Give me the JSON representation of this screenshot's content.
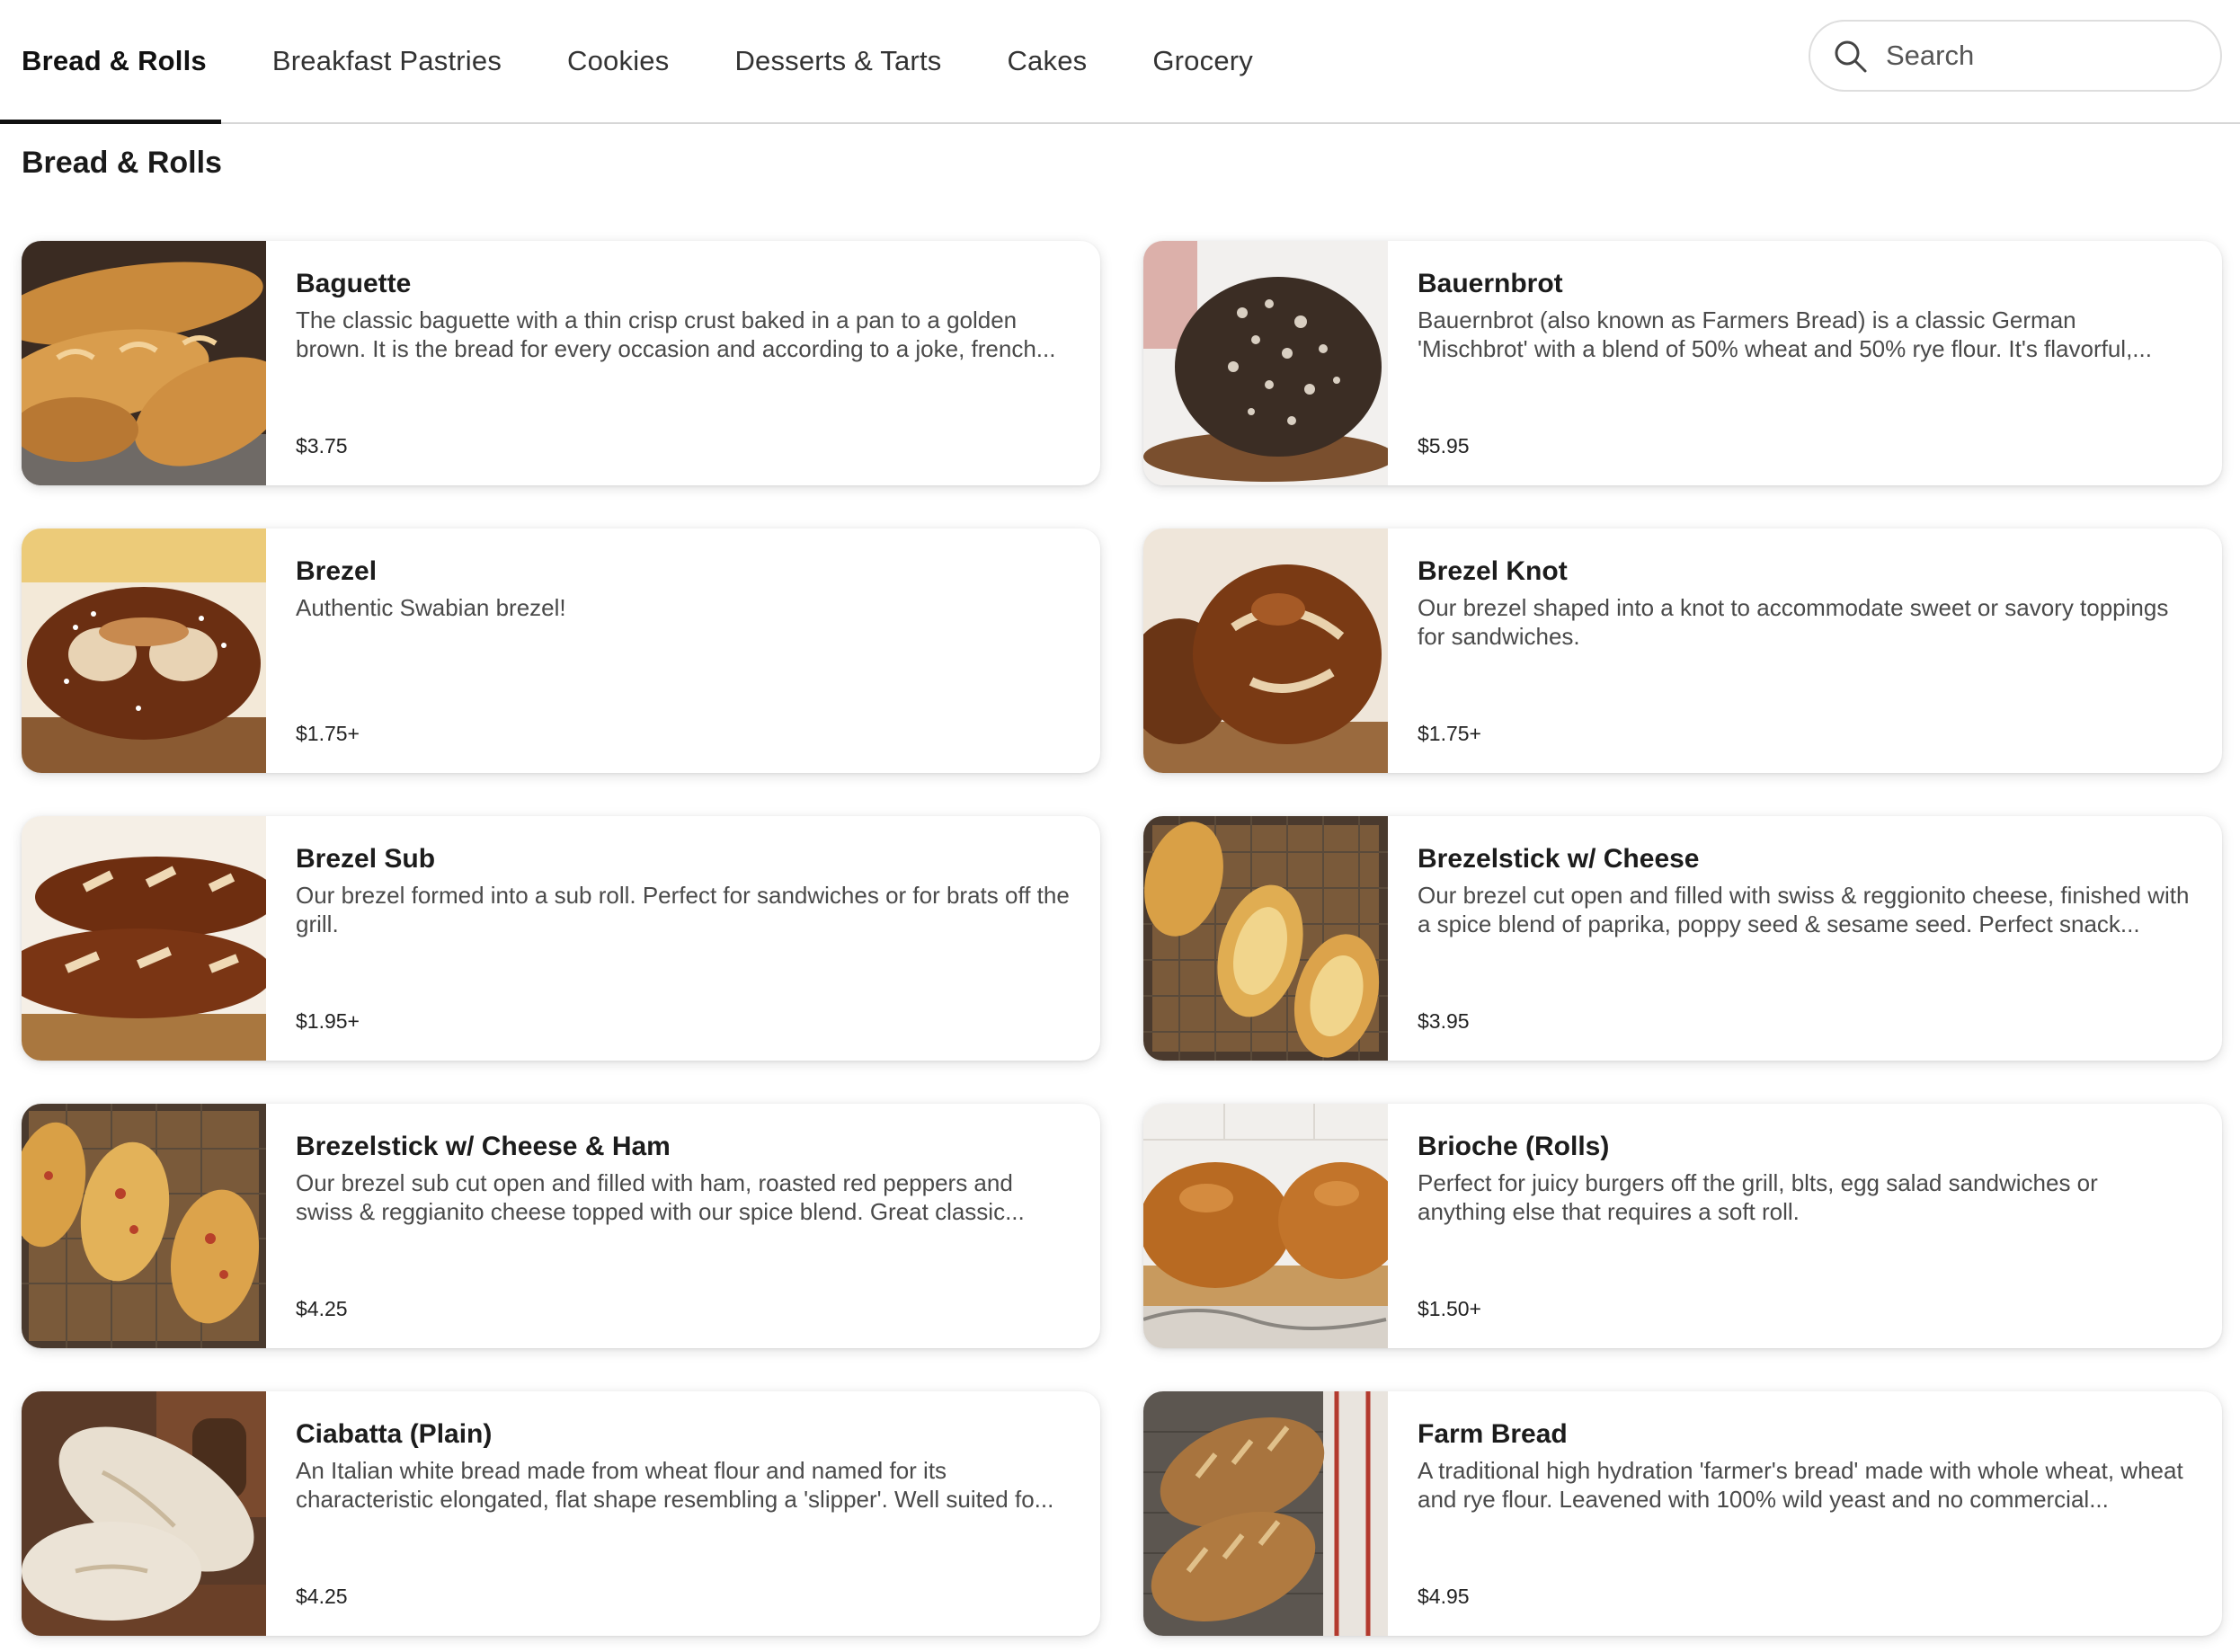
{
  "nav": {
    "tabs": [
      {
        "label": "Bread & Rolls",
        "active": true
      },
      {
        "label": "Breakfast Pastries",
        "active": false
      },
      {
        "label": "Cookies",
        "active": false
      },
      {
        "label": "Desserts & Tarts",
        "active": false
      },
      {
        "label": "Cakes",
        "active": false
      },
      {
        "label": "Grocery",
        "active": false
      }
    ],
    "search": {
      "placeholder": "Search",
      "value": ""
    }
  },
  "section": {
    "title": "Bread & Rolls"
  },
  "products": [
    {
      "name": "Baguette",
      "description": "The classic baguette with a thin crisp crust baked in a pan to a golden brown. It is the bread for every occasion and according to a joke, french...",
      "price": "$3.75",
      "image": "baguette"
    },
    {
      "name": "Bauernbrot",
      "description": "Bauernbrot (also known as Farmers Bread) is a classic German 'Mischbrot' with a blend of 50% wheat and 50% rye flour. It's flavorful,...",
      "price": "$5.95",
      "image": "dark-round-loaf"
    },
    {
      "name": "Brezel",
      "description": "Authentic Swabian brezel!",
      "price": "$1.75+",
      "image": "pretzel"
    },
    {
      "name": "Brezel Knot",
      "description": "Our brezel shaped into a knot to accommodate sweet or savory toppings for sandwiches.",
      "price": "$1.75+",
      "image": "pretzel-knot"
    },
    {
      "name": "Brezel Sub",
      "description": "Our brezel formed into a sub roll. Perfect for sandwiches or for brats off the grill.",
      "price": "$1.95+",
      "image": "pretzel-sub"
    },
    {
      "name": "Brezelstick w/ Cheese",
      "description": "Our brezel cut open and filled with swiss & reggionito cheese, finished with a spice blend of paprika, poppy seed & sesame seed. Perfect snack...",
      "price": "$3.95",
      "image": "cheese-sticks"
    },
    {
      "name": "Brezelstick w/ Cheese & Ham",
      "description": "Our brezel sub cut open and filled with ham, roasted red peppers and swiss & reggianito cheese topped with our spice blend. Great classic...",
      "price": "$4.25",
      "image": "cheese-ham-sticks"
    },
    {
      "name": "Brioche (Rolls)",
      "description": "Perfect for juicy burgers off the grill, blts, egg salad sandwiches or anything else that requires a soft roll.",
      "price": "$1.50+",
      "image": "brioche"
    },
    {
      "name": "Ciabatta (Plain)",
      "description": "An Italian white bread made from wheat flour and named for its characteristic elongated, flat shape resembling a 'slipper'. Well suited fo...",
      "price": "$4.25",
      "image": "ciabatta"
    },
    {
      "name": "Farm Bread",
      "description": "A traditional high hydration 'farmer's bread' made with whole wheat, wheat and rye flour. Leavened with 100% wild yeast and no commercial...",
      "price": "$4.95",
      "image": "farm-bread"
    }
  ]
}
